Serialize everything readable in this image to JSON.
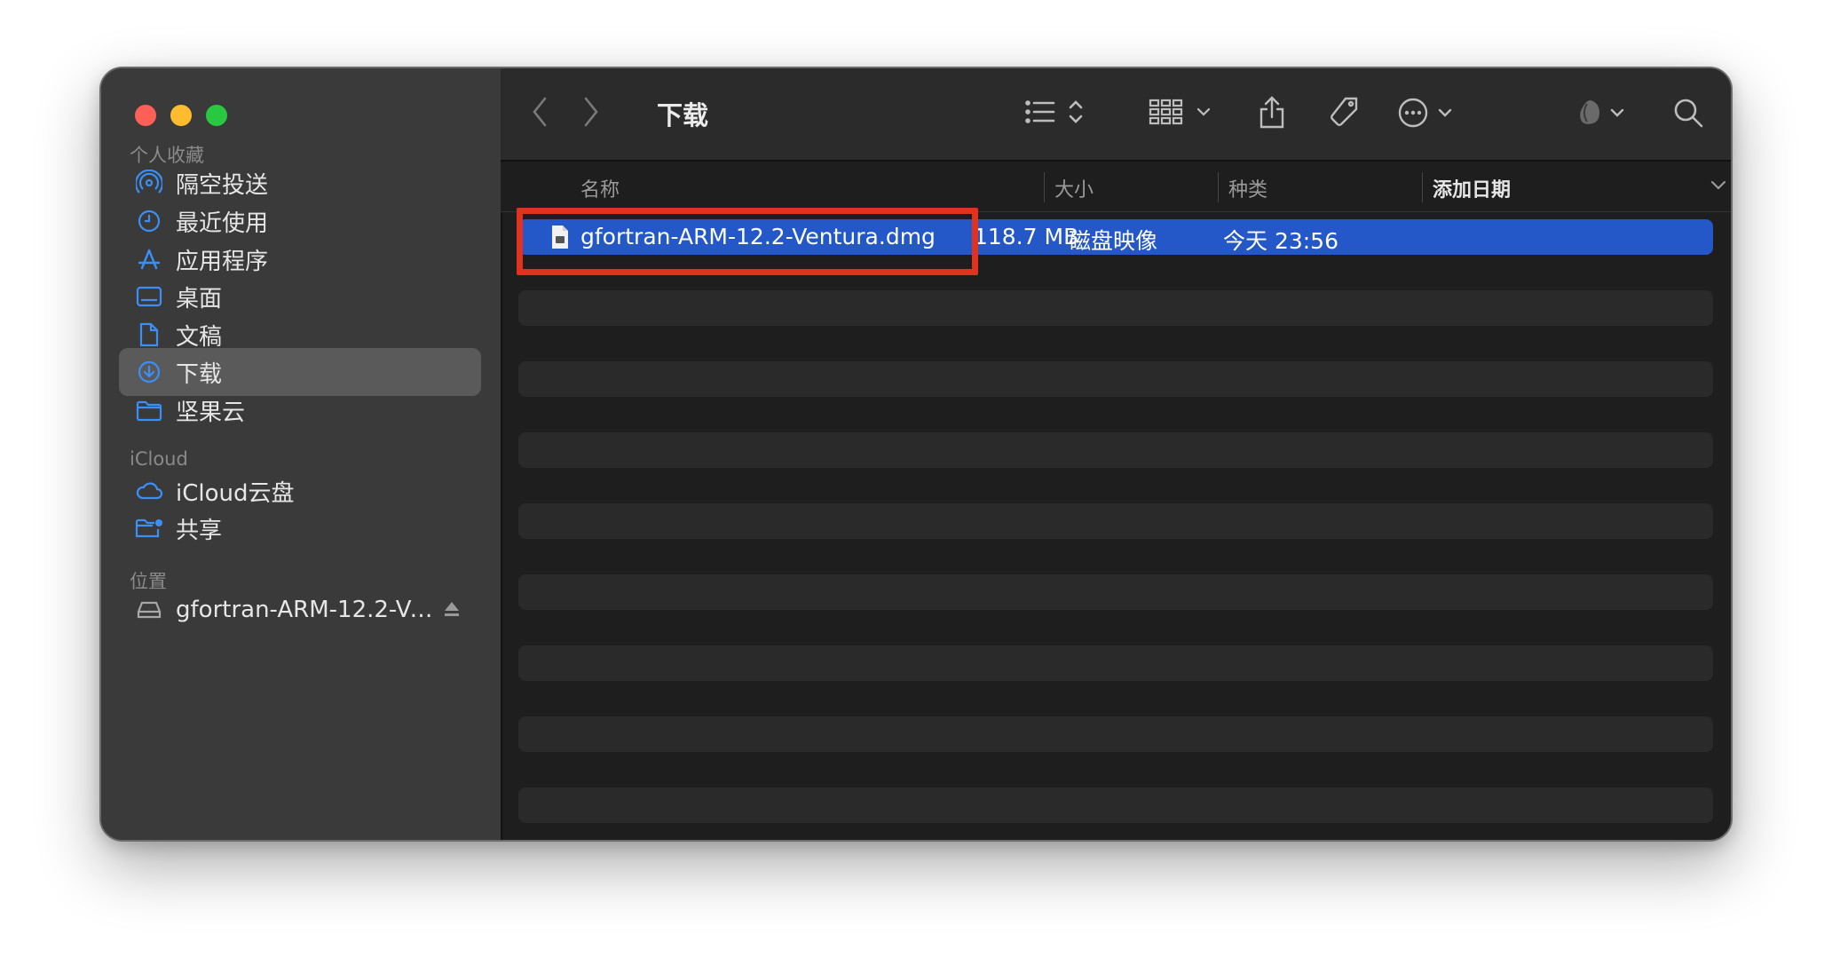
{
  "window": {
    "folder_title": "下载"
  },
  "sidebar": {
    "favorites_title": "个人收藏",
    "favorites": [
      {
        "label": "隔空投送",
        "icon": "airdrop-icon"
      },
      {
        "label": "最近使用",
        "icon": "clock-icon"
      },
      {
        "label": "应用程序",
        "icon": "applications-icon"
      },
      {
        "label": "桌面",
        "icon": "desktop-icon"
      },
      {
        "label": "文稿",
        "icon": "document-icon"
      },
      {
        "label": "下载",
        "icon": "download-icon",
        "active": true
      },
      {
        "label": "坚果云",
        "icon": "folder-icon"
      }
    ],
    "icloud_title": "iCloud",
    "icloud": [
      {
        "label": "iCloud云盘",
        "icon": "cloud-icon"
      },
      {
        "label": "共享",
        "icon": "shared-folder-icon"
      }
    ],
    "locations_title": "位置",
    "locations": [
      {
        "label": "gfortran-ARM-12.2-Ve...",
        "icon": "disk-icon",
        "eject": true
      }
    ]
  },
  "list": {
    "columns": {
      "name": "名称",
      "size": "大小",
      "kind": "种类",
      "date_added": "添加日期"
    },
    "rows": [
      {
        "name": "gfortran-ARM-12.2-Ventura.dmg",
        "size": "118.7 MB",
        "kind": "磁盘映像",
        "date_added": "今天 23:56",
        "selected": true
      }
    ]
  },
  "colors": {
    "selection": "#2458c8",
    "highlight_box": "#e0321f",
    "accent_icon": "#3b8ff6"
  }
}
